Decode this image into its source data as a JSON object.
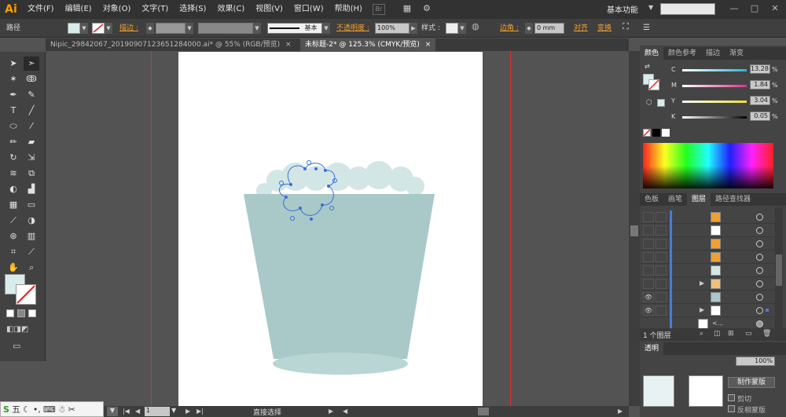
{
  "app": {
    "logo": "Ai"
  },
  "menu": [
    "文件(F)",
    "编辑(E)",
    "对象(O)",
    "文字(T)",
    "选择(S)",
    "效果(C)",
    "视图(V)",
    "窗口(W)",
    "帮助(H)"
  ],
  "menu_box": "Br",
  "workspace": "基本功能",
  "window_controls": {
    "minimize": "—",
    "restore": "□",
    "close": "✕"
  },
  "control_bar": {
    "selection_label": "路径",
    "stroke_label": "描边 :",
    "brush_label": "基本",
    "opacity_label": "不透明度 :",
    "opacity_value": "100%",
    "style_label": "样式 :",
    "corner_label": "边角 :",
    "corner_value": "0 mm",
    "align_label": "对齐",
    "transform_label": "变换"
  },
  "tabs": [
    {
      "label": "Nipic_29842067_20190907123651284000.ai* @ 55% (RGB/预览)",
      "close": "×"
    },
    {
      "label": "未标题-2* @ 125.3% (CMYK/预览)",
      "close": "×"
    }
  ],
  "color_panel": {
    "tabs": [
      "颜色",
      "颜色参考",
      "描边",
      "渐变"
    ],
    "sliders": [
      {
        "name": "C",
        "value": "13.28",
        "color": "#2fb3d6"
      },
      {
        "name": "M",
        "value": "1.84",
        "color": "#d8348c"
      },
      {
        "name": "Y",
        "value": "3.04",
        "color": "#e8e030"
      },
      {
        "name": "K",
        "value": "0.05",
        "color": "#888888"
      }
    ],
    "unit": "%"
  },
  "layers_panel": {
    "tabs": [
      "色板",
      "画笔",
      "图层",
      "路径查找器"
    ],
    "footer_label": "1 个图层",
    "expand_arrow": "▶",
    "eye_icon": "👁",
    "row_name": "<..."
  },
  "lower_panel": {
    "tab_label": "透明",
    "opacity_value": "100%",
    "make_mask_button": "制作蒙版",
    "clip_label": "剪切",
    "invert_label": "反相蒙版"
  },
  "status": {
    "zoom": "1",
    "mode": "直接选择"
  },
  "ime": {
    "label": "五"
  },
  "colors": {
    "cup": "#a8c9c8",
    "cup_bottom": "#b9d5d4",
    "foam": "#d3e6e6",
    "path_selection": "#3b6fd8"
  }
}
